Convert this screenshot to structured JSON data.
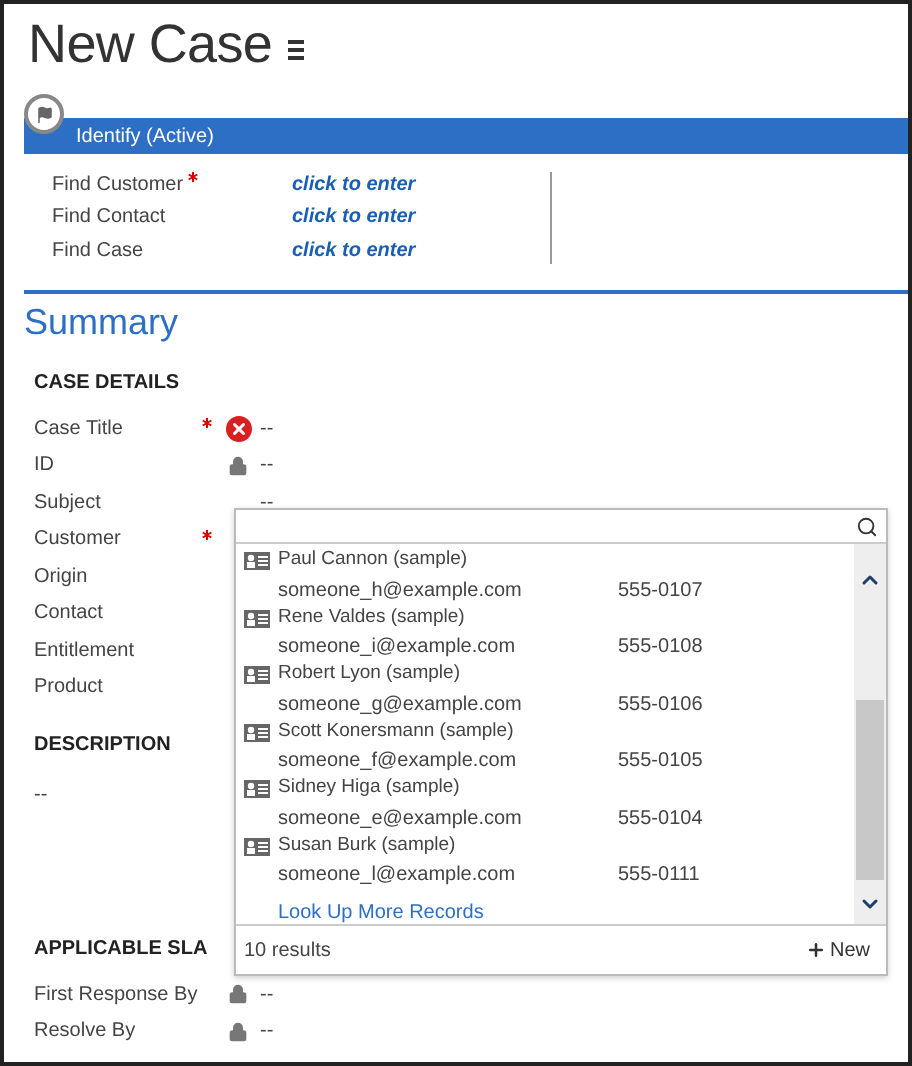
{
  "title": "New Case",
  "process": {
    "stage": "Identify (Active)",
    "fields": [
      {
        "label": "Find Customer",
        "required": true,
        "value": "click to enter"
      },
      {
        "label": "Find Contact",
        "required": false,
        "value": "click to enter"
      },
      {
        "label": "Find Case",
        "required": false,
        "value": "click to enter"
      }
    ]
  },
  "summary": {
    "heading": "Summary",
    "sections": [
      {
        "heading": "CASE DETAILS",
        "fields": [
          {
            "label": "Case Title",
            "required": true,
            "kind": "error",
            "value": "--"
          },
          {
            "label": "ID",
            "required": false,
            "kind": "locked",
            "value": "--"
          },
          {
            "label": "Subject",
            "required": false,
            "kind": "plain",
            "value": "--"
          },
          {
            "label": "Customer",
            "required": true,
            "kind": "lookup"
          },
          {
            "label": "Origin",
            "required": false,
            "kind": "hidden"
          },
          {
            "label": "Contact",
            "required": false,
            "kind": "hidden"
          },
          {
            "label": "Entitlement",
            "required": false,
            "kind": "hidden"
          },
          {
            "label": "Product",
            "required": false,
            "kind": "hidden"
          }
        ]
      },
      {
        "heading": "DESCRIPTION",
        "text": "--"
      },
      {
        "heading": "APPLICABLE SLA",
        "fields": [
          {
            "label": "First Response By",
            "required": false,
            "kind": "locked",
            "value": "--"
          },
          {
            "label": "Resolve By",
            "required": false,
            "kind": "locked",
            "value": "--"
          }
        ]
      }
    ]
  },
  "lookup": {
    "results": [
      {
        "name": "Paul Cannon (sample)",
        "email": "someone_h@example.com",
        "phone": "555-0107"
      },
      {
        "name": "Rene Valdes (sample)",
        "email": "someone_i@example.com",
        "phone": "555-0108"
      },
      {
        "name": "Robert Lyon (sample)",
        "email": "someone_g@example.com",
        "phone": "555-0106"
      },
      {
        "name": "Scott Konersmann (sample)",
        "email": "someone_f@example.com",
        "phone": "555-0105"
      },
      {
        "name": "Sidney Higa (sample)",
        "email": "someone_e@example.com",
        "phone": "555-0104"
      },
      {
        "name": "Susan Burk (sample)",
        "email": "someone_l@example.com",
        "phone": "555-0111"
      }
    ],
    "more_link": "Look Up More Records",
    "count": "10 results",
    "new_label": "New"
  }
}
